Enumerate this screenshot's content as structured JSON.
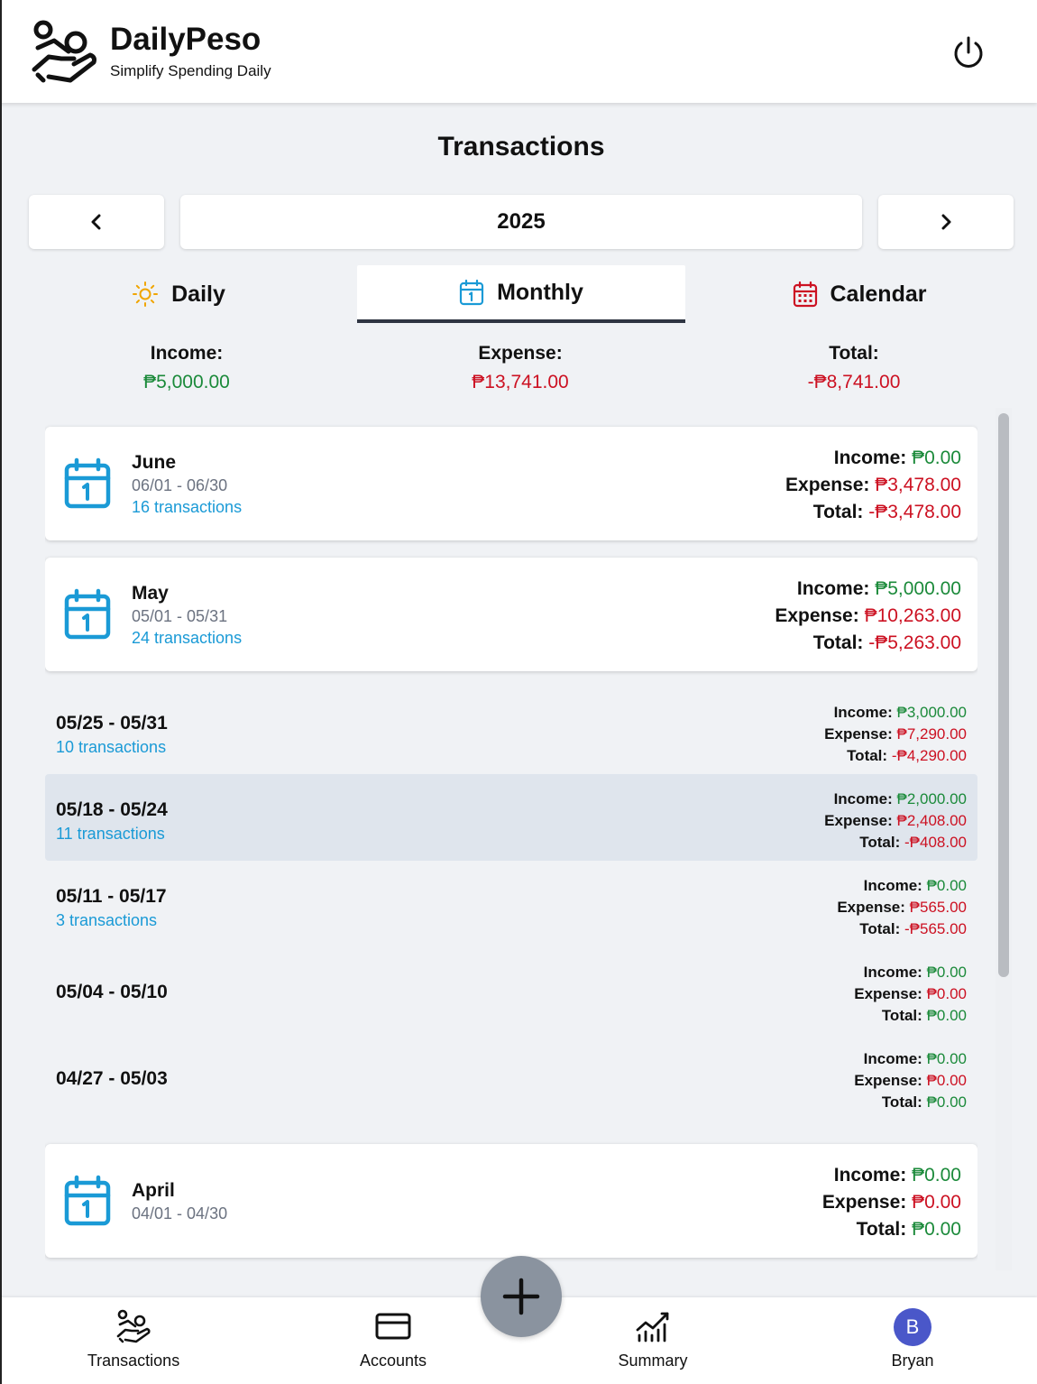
{
  "app": {
    "name": "DailyPeso",
    "tagline": "Simplify Spending Daily"
  },
  "page": {
    "title": "Transactions"
  },
  "year_nav": {
    "year": "2025"
  },
  "tabs": [
    {
      "label": "Daily",
      "icon": "sun-icon",
      "active": false
    },
    {
      "label": "Monthly",
      "icon": "calendar-icon",
      "active": true
    },
    {
      "label": "Calendar",
      "icon": "calendar-grid-icon",
      "active": false
    }
  ],
  "summary": {
    "income_label": "Income:",
    "income_value": "₱5,000.00",
    "expense_label": "Expense:",
    "expense_value": "₱13,741.00",
    "total_label": "Total:",
    "total_value": "-₱8,741.00"
  },
  "labels": {
    "income": "Income:",
    "expense": "Expense:",
    "total": "Total:"
  },
  "months": [
    {
      "name": "June",
      "range": "06/01 - 06/30",
      "count": "16 transactions",
      "income": "₱0.00",
      "expense": "₱3,478.00",
      "total": "-₱3,478.00"
    },
    {
      "name": "May",
      "range": "05/01 - 05/31",
      "count": "24 transactions",
      "income": "₱5,000.00",
      "expense": "₱10,263.00",
      "total": "-₱5,263.00"
    },
    {
      "name": "April",
      "range": "04/01 - 04/30",
      "count": "",
      "income": "₱0.00",
      "expense": "₱0.00",
      "total": "₱0.00"
    }
  ],
  "weeks": [
    {
      "range": "05/25 - 05/31",
      "count": "10 transactions",
      "income": "₱3,000.00",
      "expense": "₱7,290.00",
      "total": "-₱4,290.00",
      "selected": false
    },
    {
      "range": "05/18 - 05/24",
      "count": "11 transactions",
      "income": "₱2,000.00",
      "expense": "₱2,408.00",
      "total": "-₱408.00",
      "selected": true
    },
    {
      "range": "05/11 - 05/17",
      "count": "3 transactions",
      "income": "₱0.00",
      "expense": "₱565.00",
      "total": "-₱565.00",
      "selected": false
    },
    {
      "range": "05/04 - 05/10",
      "count": "",
      "income": "₱0.00",
      "expense": "₱0.00",
      "total": "₱0.00",
      "selected": false
    },
    {
      "range": "04/27 - 05/03",
      "count": "",
      "income": "₱0.00",
      "expense": "₱0.00",
      "total": "₱0.00",
      "selected": false
    }
  ],
  "bottom_nav": [
    {
      "label": "Transactions",
      "icon": "hand-coins-icon"
    },
    {
      "label": "Accounts",
      "icon": "credit-card-icon"
    },
    {
      "label": "Summary",
      "icon": "chart-icon"
    },
    {
      "label": "Bryan",
      "icon": "avatar",
      "initial": "B"
    }
  ],
  "colors": {
    "income": "#1b8a3a",
    "expense": "#cc1122",
    "link": "#1a9ad6",
    "fab": "#8a939f",
    "avatar": "#4a57c9"
  }
}
